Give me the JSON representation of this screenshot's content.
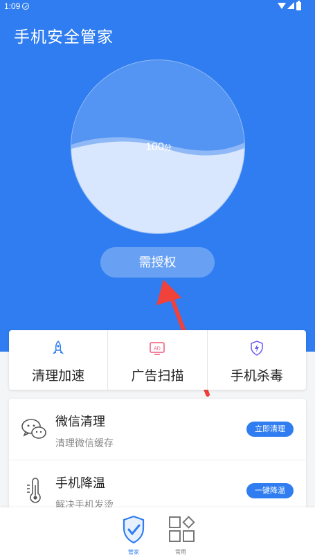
{
  "status_bar": {
    "time": "1:09"
  },
  "app": {
    "title": "手机安全管家"
  },
  "score": {
    "value": "100",
    "unit": "分",
    "level": 0.5
  },
  "auth_button": {
    "label": "需授权"
  },
  "tools": [
    {
      "label": "清理加速",
      "icon": "rocket-icon"
    },
    {
      "label": "广告扫描",
      "icon": "ad-icon"
    },
    {
      "label": "手机杀毒",
      "icon": "shield-lightning-icon"
    }
  ],
  "list": [
    {
      "title": "微信清理",
      "subtitle": "清理微信缓存",
      "action": "立即清理",
      "icon": "wechat-icon"
    },
    {
      "title": "手机降温",
      "subtitle": "解决手机发烫",
      "action": "一键降温",
      "icon": "thermometer-icon"
    }
  ],
  "nav": [
    {
      "label": "管家",
      "icon": "shield-check-icon",
      "active": true
    },
    {
      "label": "常用",
      "icon": "apps-grid-icon",
      "active": false
    }
  ],
  "colors": {
    "brand": "#2f7df0",
    "accent_arrow": "#f0413a"
  }
}
